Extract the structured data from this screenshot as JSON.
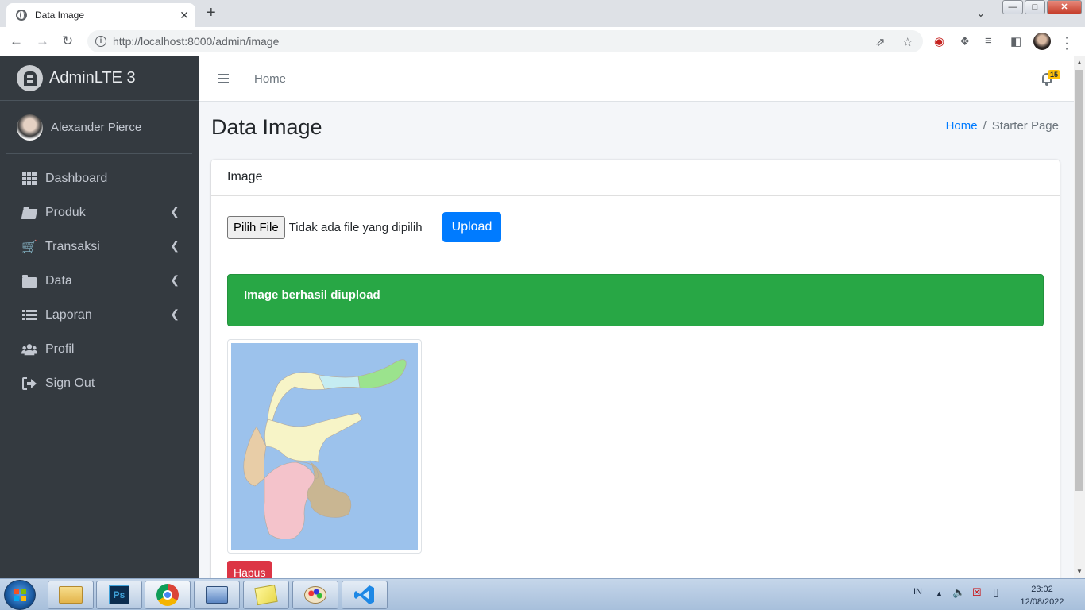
{
  "browser": {
    "tab_title": "Data Image",
    "tab_close": "✕",
    "new_tab": "+",
    "url": "http://localhost:8000/admin/image"
  },
  "sidebar": {
    "brand": "AdminLTE 3",
    "user_name": "Alexander Pierce",
    "items": [
      {
        "label": "Dashboard",
        "icon": "grid-icon",
        "has_children": false
      },
      {
        "label": "Produk",
        "icon": "folder-open-icon",
        "has_children": true
      },
      {
        "label": "Transaksi",
        "icon": "cart-icon",
        "has_children": true
      },
      {
        "label": "Data",
        "icon": "folder-icon",
        "has_children": true
      },
      {
        "label": "Laporan",
        "icon": "list-icon",
        "has_children": true
      },
      {
        "label": "Profil",
        "icon": "users-icon",
        "has_children": false
      },
      {
        "label": "Sign Out",
        "icon": "sign-out-icon",
        "has_children": false
      }
    ]
  },
  "topnav": {
    "home_link": "Home",
    "notification_count": "15"
  },
  "page": {
    "title": "Data Image",
    "breadcrumb": {
      "home": "Home",
      "separator": "/",
      "current": "Starter Page"
    }
  },
  "card": {
    "header": "Image",
    "file_button": "Pilih File",
    "file_status": "Tidak ada file yang dipilih",
    "upload_button": "Upload",
    "alert_success": "Image berhasil diupload",
    "delete_button": "Hapus"
  },
  "taskbar": {
    "language": "IN",
    "time": "23:02",
    "date": "12/08/2022"
  },
  "colors": {
    "sidebar_bg": "#343a40",
    "primary": "#007bff",
    "success": "#28a745",
    "danger": "#dc3545",
    "warning_badge": "#ffc107"
  }
}
